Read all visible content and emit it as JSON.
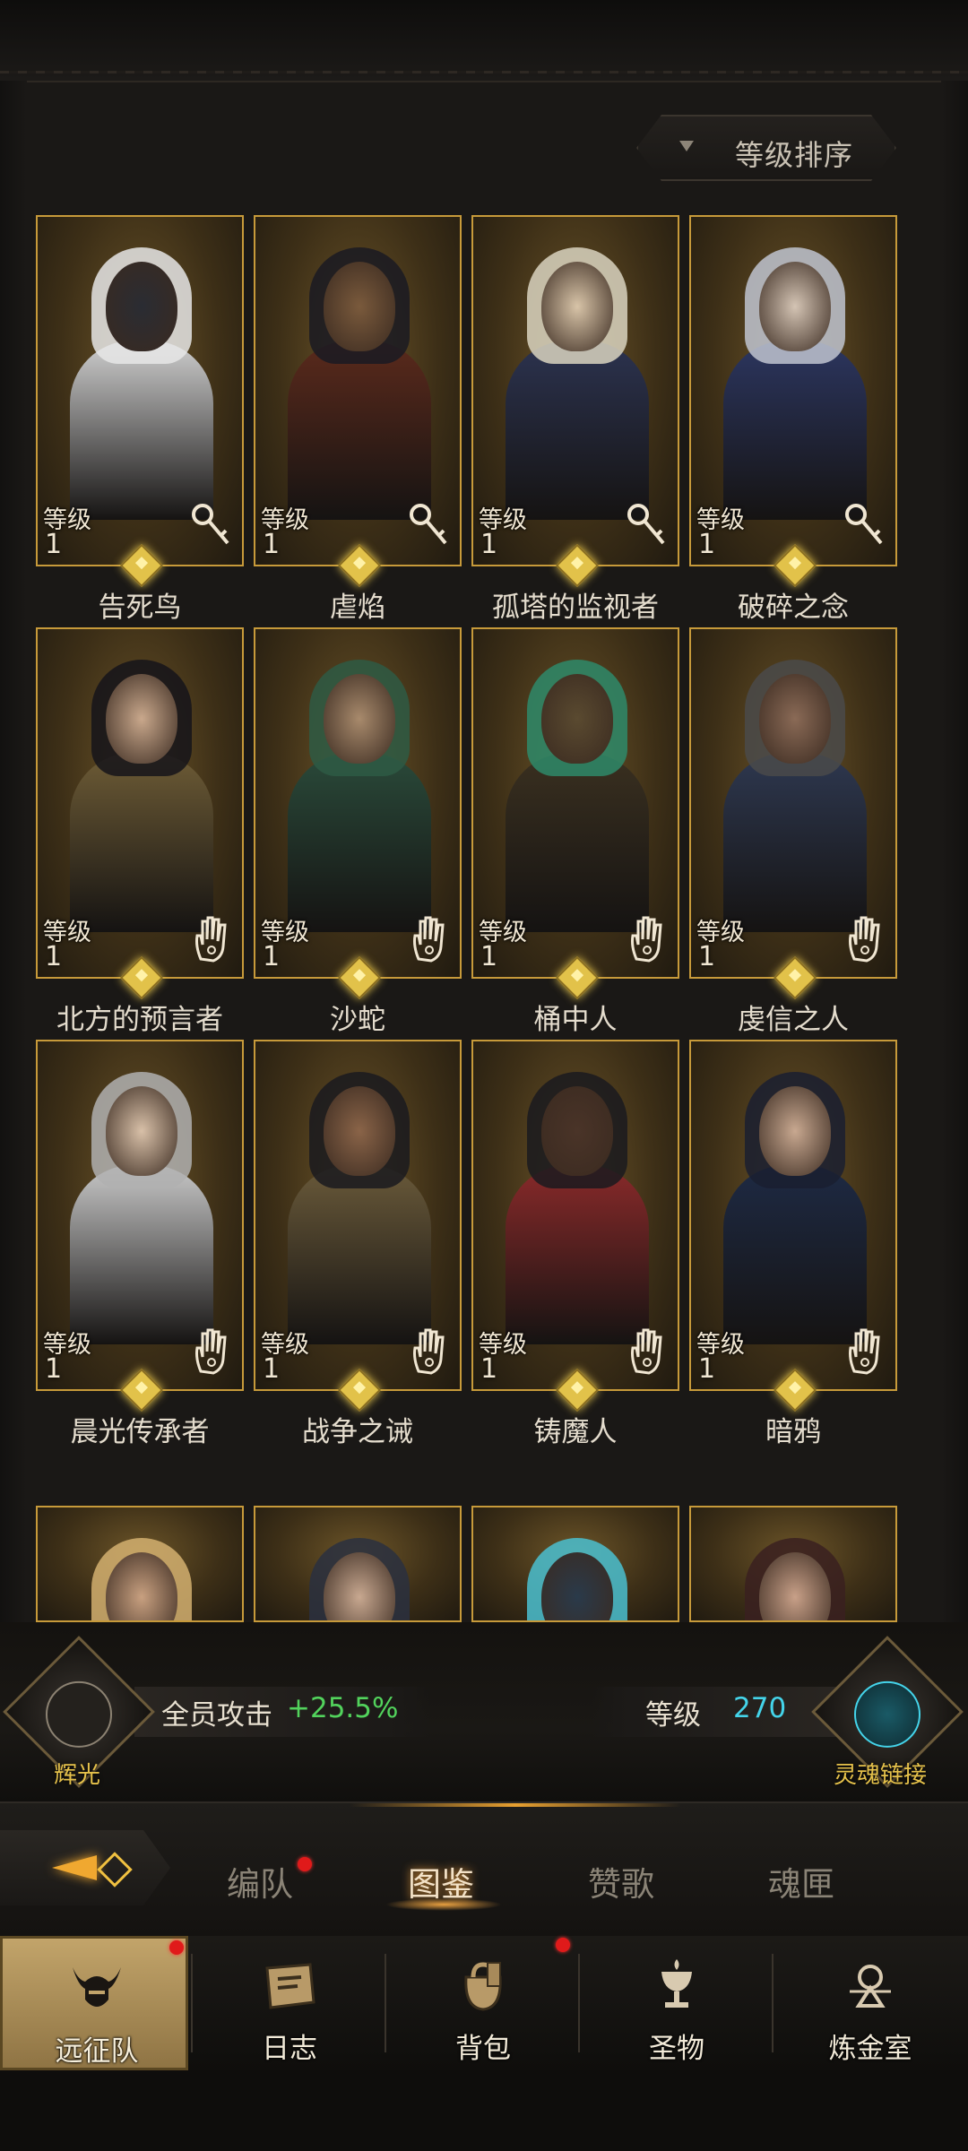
{
  "sort_button": {
    "label": "等级排序"
  },
  "level_label": "等级",
  "heroes": [
    {
      "name": "告死鸟",
      "level": "1",
      "class_icon": "key-icon",
      "palette": [
        "#2a2c33",
        "#cfcfcf",
        "#e6e6e6"
      ]
    },
    {
      "name": "虐焰",
      "level": "1",
      "class_icon": "key-icon",
      "palette": [
        "#7a5a3c",
        "#5b2a1c",
        "#1a1a22"
      ]
    },
    {
      "name": "孤塔的监视者",
      "level": "1",
      "class_icon": "key-icon",
      "palette": [
        "#d8c4a8",
        "#2c3350",
        "#d9d4c0"
      ]
    },
    {
      "name": "破碎之念",
      "level": "1",
      "class_icon": "key-icon",
      "palette": [
        "#d4c4b4",
        "#2c3660",
        "#bfc4d0"
      ]
    },
    {
      "name": "北方的预言者",
      "level": "1",
      "class_icon": "hand-icon",
      "palette": [
        "#c9a88c",
        "#6e5c36",
        "#15141a"
      ]
    },
    {
      "name": "沙蛇",
      "level": "1",
      "class_icon": "hand-icon",
      "palette": [
        "#a88a6c",
        "#2a4a3a",
        "#2e5b44"
      ]
    },
    {
      "name": "桶中人",
      "level": "1",
      "class_icon": "hand-icon",
      "palette": [
        "#5a4a30",
        "#3a3020",
        "#2e8a6a"
      ]
    },
    {
      "name": "虔信之人",
      "level": "1",
      "class_icon": "hand-icon",
      "palette": [
        "#8a6a56",
        "#2e3850",
        "#4a4a4a"
      ]
    },
    {
      "name": "晨光传承者",
      "level": "1",
      "class_icon": "hand-icon",
      "palette": [
        "#d8c0a8",
        "#c8c8c8",
        "#b0b0b0"
      ]
    },
    {
      "name": "战争之诫",
      "level": "1",
      "class_icon": "hand-icon",
      "palette": [
        "#8a6448",
        "#6a5a3a",
        "#1a1a1e"
      ]
    },
    {
      "name": "铸魔人",
      "level": "1",
      "class_icon": "hand-icon",
      "palette": [
        "#4a3428",
        "#8a2a2a",
        "#1a1a1e"
      ]
    },
    {
      "name": "暗鸦",
      "level": "1",
      "class_icon": "hand-icon",
      "palette": [
        "#c8a890",
        "#1e2a44",
        "#1a1f30"
      ]
    }
  ],
  "partial_heroes": [
    {
      "palette": [
        "#c8a080",
        "#8a6a3a",
        "#d4b070"
      ]
    },
    {
      "palette": [
        "#c8a890",
        "#3a4a5a",
        "#2a3040"
      ]
    },
    {
      "palette": [
        "#2a3a4a",
        "#1a2030",
        "#4ac0d0"
      ]
    },
    {
      "palette": [
        "#c8a088",
        "#4a2a2a",
        "#3a2020"
      ]
    }
  ],
  "stats": {
    "left_badge": "辉光",
    "attack_label": "全员攻击",
    "attack_value": "+25.5%",
    "level_label": "等级",
    "level_value": "270",
    "right_badge": "灵魂链接"
  },
  "tabs": [
    {
      "label": "编队",
      "active": false,
      "dot": true
    },
    {
      "label": "图鉴",
      "active": true,
      "dot": false
    },
    {
      "label": "赞歌",
      "active": false,
      "dot": false
    },
    {
      "label": "魂匣",
      "active": false,
      "dot": false
    }
  ],
  "nav": [
    {
      "label": "远征队",
      "icon": "viking-helmet-icon",
      "active": true,
      "dot": true
    },
    {
      "label": "日志",
      "icon": "scroll-icon",
      "active": false,
      "dot": false
    },
    {
      "label": "背包",
      "icon": "bag-icon",
      "active": false,
      "dot": true
    },
    {
      "label": "圣物",
      "icon": "chalice-icon",
      "active": false,
      "dot": false
    },
    {
      "label": "炼金室",
      "icon": "alchemy-icon",
      "active": false,
      "dot": false
    }
  ]
}
